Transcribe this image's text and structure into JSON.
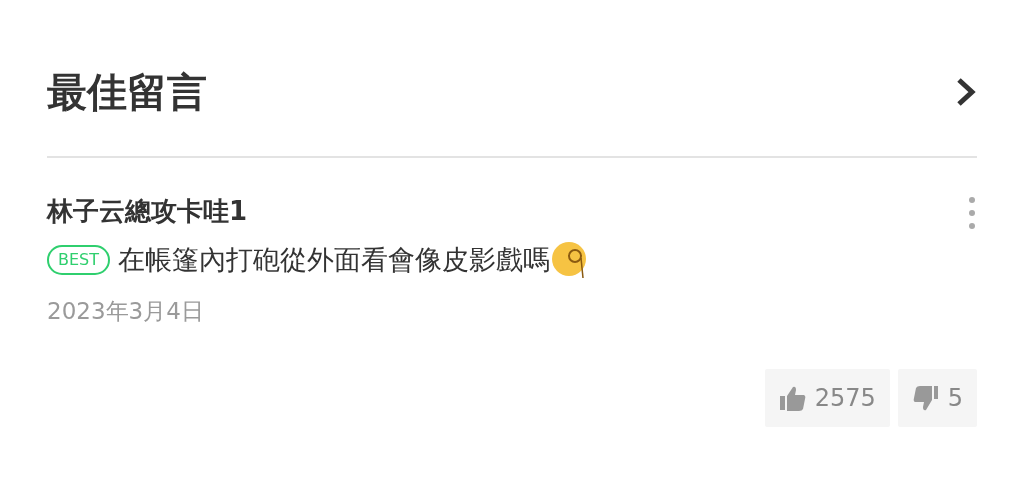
{
  "section": {
    "title": "最佳留言"
  },
  "comment": {
    "author": "林子云總攻卡哇1",
    "badge": "BEST",
    "text": "在帳篷內打砲從外面看會像皮影戲嗎",
    "date": "2023年3月4日"
  },
  "reactions": [
    {
      "kind": "like",
      "count": "2575"
    },
    {
      "kind": "dislike",
      "count": "5"
    }
  ]
}
